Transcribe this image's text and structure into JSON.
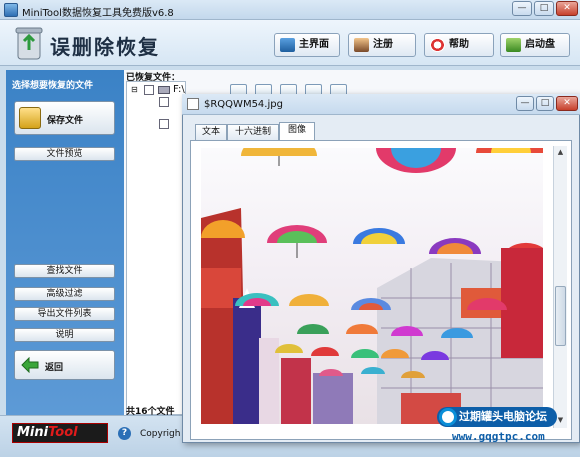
{
  "window": {
    "title": "MiniTool数据恢复工具免费版v6.8",
    "app_title": "误删除恢复"
  },
  "toolbar": {
    "home": "主界面",
    "register": "注册",
    "help": "帮助",
    "bootdisk": "启动盘"
  },
  "sidebar": {
    "title": "选择想要恢复的文件",
    "save_files": "保存文件",
    "file_preview": "文件预览",
    "find_files": "查找文件",
    "advanced_filter": "高级过滤",
    "export_list": "导出文件列表",
    "instructions": "说明",
    "back": "返回"
  },
  "main": {
    "recovered_label": "已恢复文件：",
    "tree_drive": "F:\\",
    "file_count": "共16个文件",
    "copyright": "Copyrigh"
  },
  "preview_dialog": {
    "title": "$RQQWM54.jpg",
    "tabs": [
      "文本",
      "十六进制",
      "图像"
    ],
    "active_tab": "图像"
  },
  "brand": {
    "logo_mini": "Mini",
    "logo_tool": "Tool"
  },
  "watermark": {
    "line1": "过期罐头电脑论坛",
    "line2": "www.gqgtpc.com"
  },
  "colors": {
    "left_panel": "#3b82c6",
    "accent": "#0d5ea8"
  },
  "icons": {
    "home": "home-icon",
    "register": "user-icon",
    "help": "lifebuoy-icon",
    "bootdisk": "disk-icon",
    "save": "save-icon",
    "back": "back-arrow-icon"
  }
}
